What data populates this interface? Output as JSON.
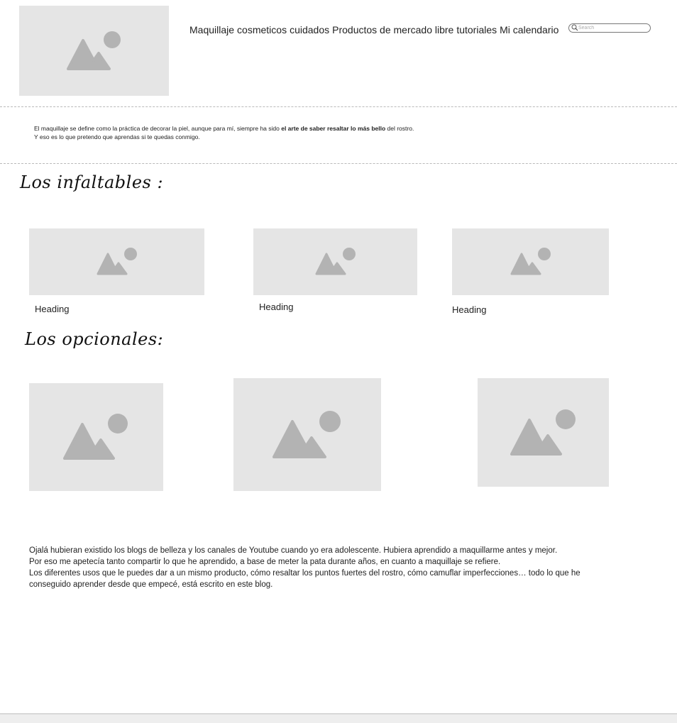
{
  "header": {
    "logo_icon": "image-placeholder-icon",
    "nav": [
      "Maquillaje",
      "cosmeticos",
      "cuidados",
      "Productos de mercado libre",
      "tutoriales",
      "Mi calendario"
    ],
    "search_placeholder": "Search",
    "search_icon": "search-icon"
  },
  "intro": {
    "line1_start": "El maquillaje se define como la práctica de decorar la piel, aunque para mí, siempre ha sido ",
    "line1_bold": "el arte de saber resaltar lo más bello",
    "line1_end": " del rostro.",
    "line2": "Y eso es lo que pretendo que aprendas si te quedas conmigo."
  },
  "infaltables": {
    "title": "Los infaltables :",
    "cards": [
      {
        "heading": "Heading"
      },
      {
        "heading": "Heading"
      },
      {
        "heading": "Heading"
      }
    ]
  },
  "opcionales": {
    "title": "Los opcionales:"
  },
  "outro": {
    "line1": "Ojalá hubieran existido los blogs de belleza y los canales de Youtube cuando yo era adolescente. Hubiera aprendido a maquillarme antes y mejor.",
    "line2": "Por eso me apetecía tanto compartir lo que he aprendido, a base de meter la pata durante años, en cuanto a maquillaje se refiere.",
    "line3": "Los diferentes usos que le puedes dar a un mismo producto, cómo resaltar los puntos fuertes del rostro, cómo camuflar imperfecciones… todo lo que he conseguido aprender desde que empecé, está escrito en este blog."
  },
  "colors": {
    "placeholder_bg": "#e5e5e5",
    "placeholder_icon": "#b3b3b3"
  }
}
